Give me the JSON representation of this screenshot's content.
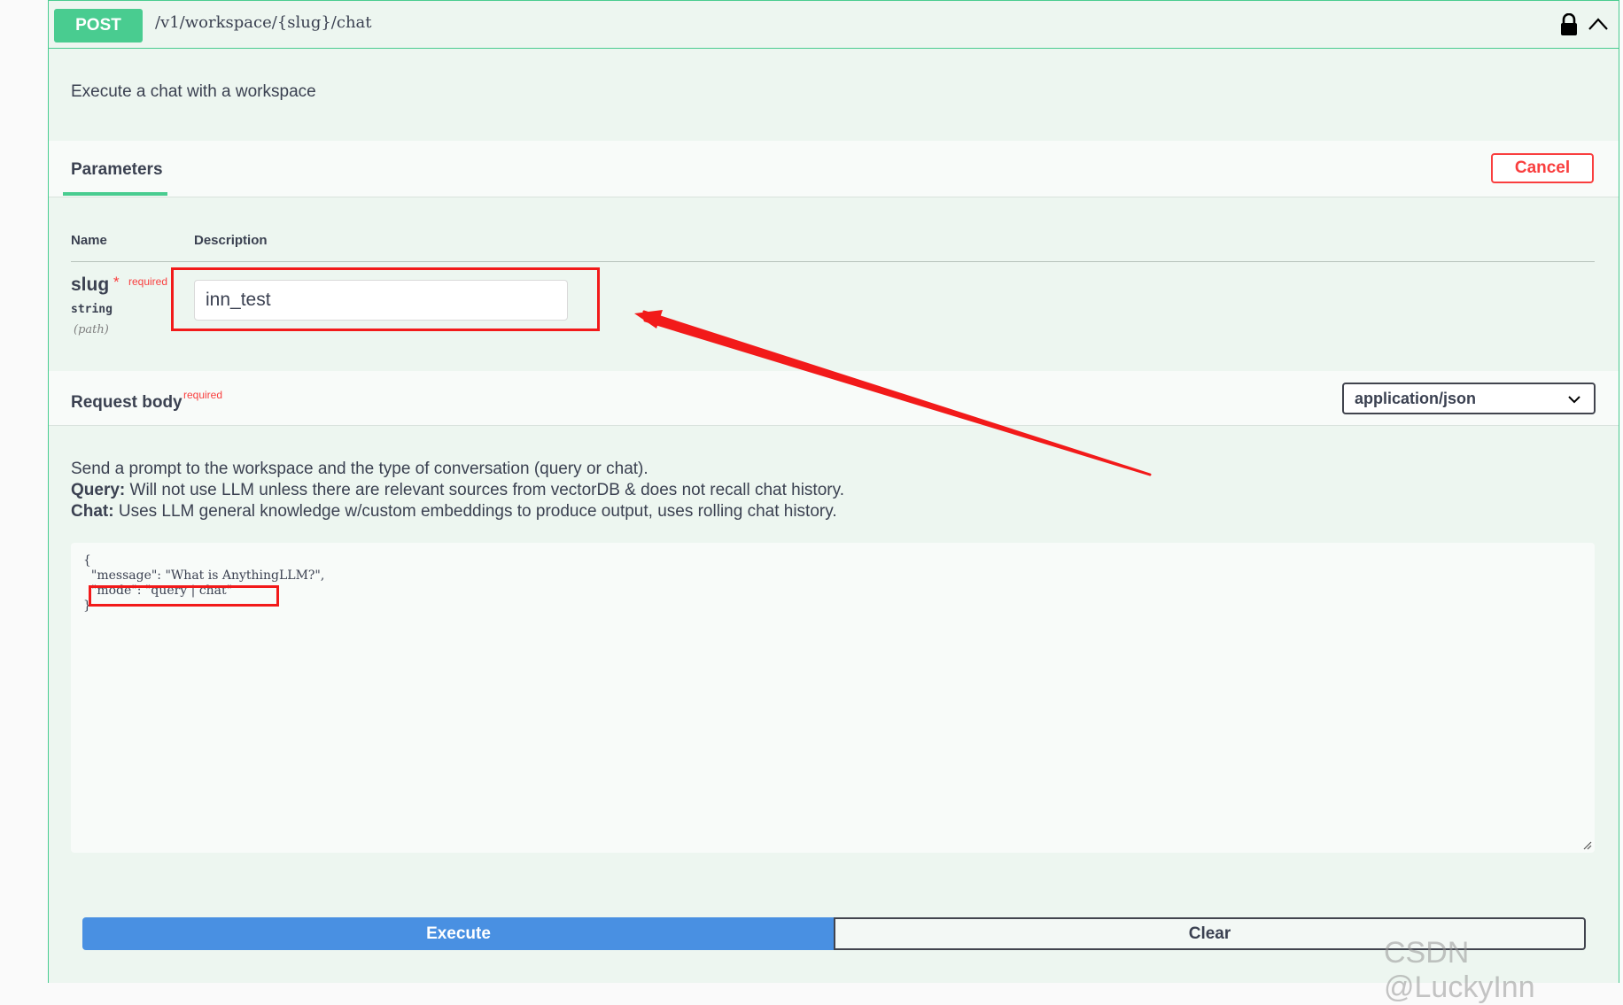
{
  "operation": {
    "method": "POST",
    "path": "/v1/workspace/{slug}/chat",
    "summary": "Execute a chat with a workspace",
    "icons": {
      "lock": "lock-icon",
      "collapse": "chevron-up-icon"
    }
  },
  "parameters": {
    "tab_label": "Parameters",
    "cancel_label": "Cancel",
    "columns": {
      "name": "Name",
      "description": "Description"
    },
    "items": [
      {
        "name": "slug",
        "required_star": "*",
        "required_label": "required",
        "type": "string",
        "in": "(path)",
        "value": "inn_test"
      }
    ]
  },
  "request_body": {
    "title": "Request body",
    "required_label": "required",
    "content_type": "application/json",
    "description": {
      "line1": "Send a prompt to the workspace and the type of conversation (query or chat).",
      "query_label": "Query:",
      "query_text": " Will not use LLM unless there are relevant sources from vectorDB & does not recall chat history.",
      "chat_label": "Chat:",
      "chat_text": " Uses LLM general knowledge w/custom embeddings to produce output, uses rolling chat history."
    },
    "example": "{\n  \"message\": \"What is AnythingLLM?\",\n  \"mode\": \"query | chat\"\n}"
  },
  "actions": {
    "execute": "Execute",
    "clear": "Clear"
  },
  "watermark": "CSDN @LuckyInn",
  "colors": {
    "post": "#49cc90",
    "execute": "#4990e2",
    "danger": "#f93e3e",
    "annotation": "#f21a1a"
  }
}
